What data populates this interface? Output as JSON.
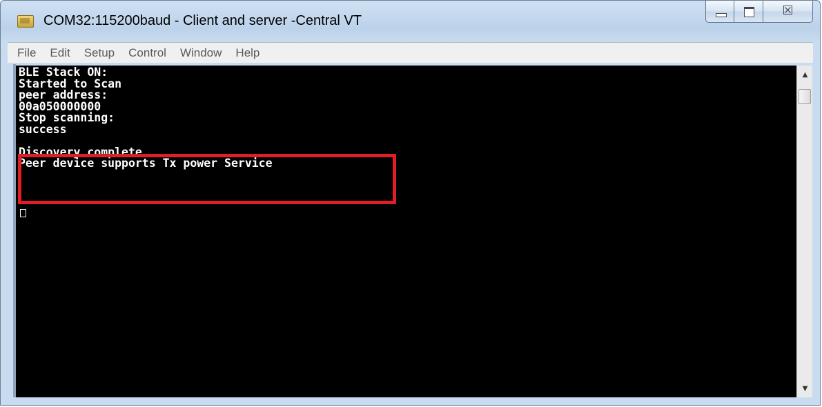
{
  "window": {
    "title": "COM32:115200baud - Client and server -Central VT",
    "icon": "terminal-app-icon",
    "controls": {
      "minimize": "minimize-icon",
      "maximize": "maximize-icon",
      "close_glyph": "☒",
      "close": "close-icon"
    }
  },
  "menu": {
    "items": [
      "File",
      "Edit",
      "Setup",
      "Control",
      "Window",
      "Help"
    ]
  },
  "terminal": {
    "lines": [
      "BLE Stack ON:",
      "Started to Scan",
      "peer address:",
      "00a050000000",
      "Stop scanning:",
      "success",
      "",
      "Discovery complete.",
      "Peer device supports Tx power Service"
    ],
    "highlight_color": "#e01e26",
    "background": "#000000",
    "foreground": "#ffffff"
  },
  "scrollbar": {
    "up": "▲",
    "down": "▼"
  }
}
